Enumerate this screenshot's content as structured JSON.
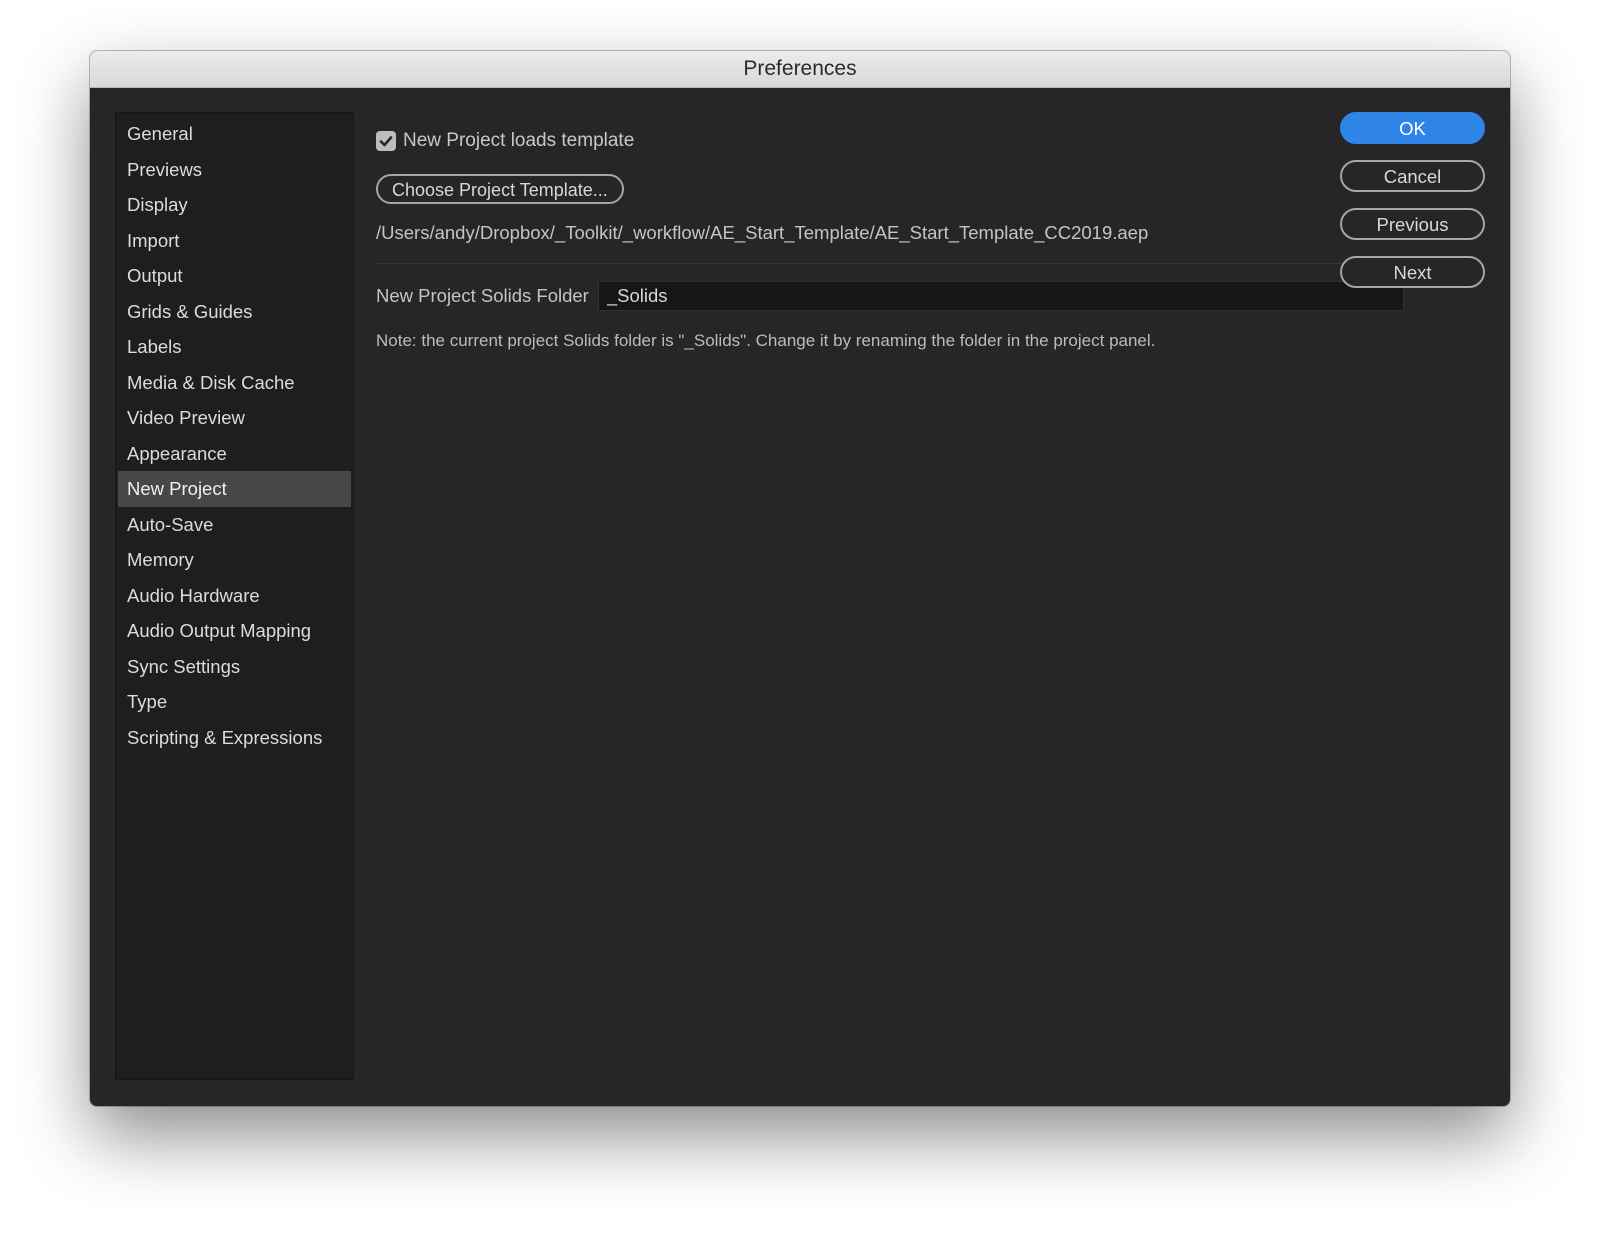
{
  "window": {
    "title": "Preferences"
  },
  "sidebar": {
    "items": [
      {
        "label": "General"
      },
      {
        "label": "Previews"
      },
      {
        "label": "Display"
      },
      {
        "label": "Import"
      },
      {
        "label": "Output"
      },
      {
        "label": "Grids & Guides"
      },
      {
        "label": "Labels"
      },
      {
        "label": "Media & Disk Cache"
      },
      {
        "label": "Video Preview"
      },
      {
        "label": "Appearance"
      },
      {
        "label": "New Project",
        "selected": true
      },
      {
        "label": "Auto-Save"
      },
      {
        "label": "Memory"
      },
      {
        "label": "Audio Hardware"
      },
      {
        "label": "Audio Output Mapping"
      },
      {
        "label": "Sync Settings"
      },
      {
        "label": "Type"
      },
      {
        "label": "Scripting & Expressions"
      }
    ]
  },
  "content": {
    "load_template": {
      "label": "New Project loads template",
      "checked": true
    },
    "choose_template_button": "Choose Project Template...",
    "template_path": "/Users/andy/Dropbox/_Toolkit/_workflow/AE_Start_Template/AE_Start_Template_CC2019.aep",
    "solids_folder": {
      "label": "New Project Solids Folder",
      "value": "_Solids"
    },
    "note": "Note: the current project Solids folder is \"_Solids\". Change it by renaming the folder in the project panel."
  },
  "buttons": {
    "ok": "OK",
    "cancel": "Cancel",
    "previous": "Previous",
    "next": "Next"
  },
  "colors": {
    "accent": "#2f84e8",
    "panel_bg": "#262626",
    "sidebar_bg": "#1e1e1e",
    "selected_bg": "#474747"
  }
}
